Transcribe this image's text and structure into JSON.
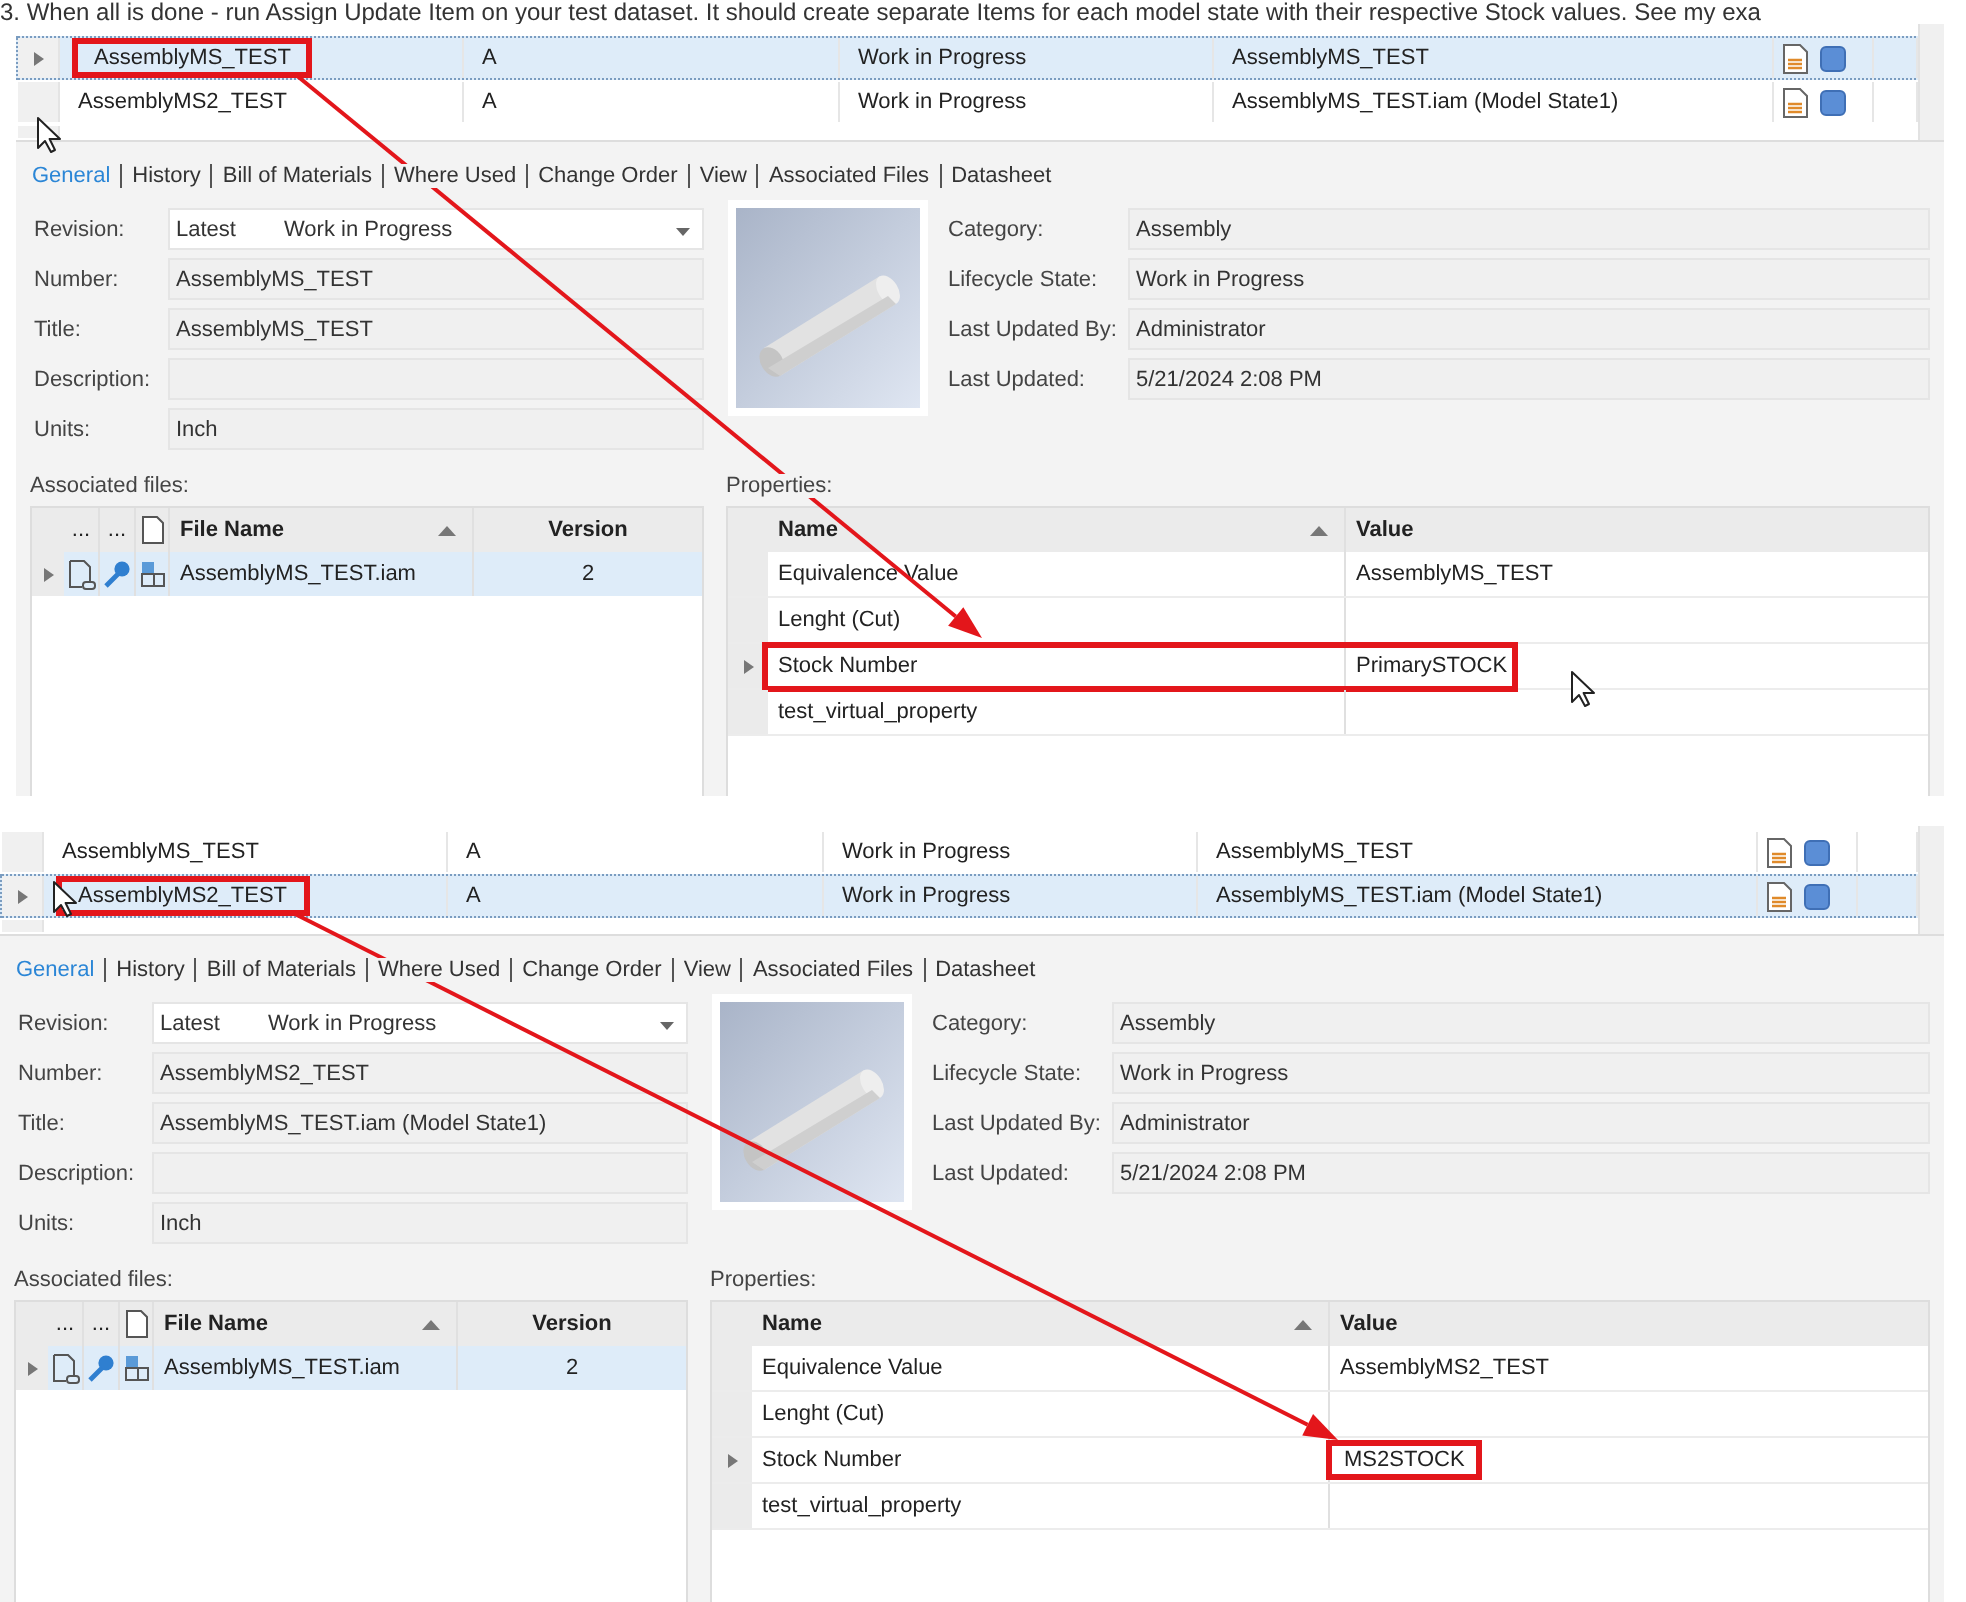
{
  "instruction": "3. When all is done - run Assign Update Item on your test dataset. It should create separate Items for each model state with their respective Stock values. See my exa",
  "panels": [
    {
      "rows": [
        {
          "name": "AssemblyMS_TEST",
          "revision": "A",
          "state": "Work in Progress",
          "title": "AssemblyMS_TEST",
          "selected": true,
          "annotated": true
        },
        {
          "name": "AssemblyMS2_TEST",
          "revision": "A",
          "state": "Work in Progress",
          "title": "AssemblyMS_TEST.iam (Model State1)",
          "selected": false,
          "annotated": false
        }
      ],
      "tabs": [
        {
          "label": "General",
          "selected": true
        },
        {
          "label": "History",
          "selected": false
        },
        {
          "label": "Bill of Materials",
          "selected": false
        },
        {
          "label": "Where Used",
          "selected": false
        },
        {
          "label": "Change Order",
          "selected": false
        },
        {
          "label": "View",
          "selected": false
        },
        {
          "label": "Associated Files",
          "selected": false
        },
        {
          "label": "Datasheet",
          "selected": false
        }
      ],
      "fields": [
        {
          "label": "Revision:",
          "kind": "dropdown",
          "value": "Latest",
          "state": "Work in Progress"
        },
        {
          "label": "Number:",
          "kind": "text",
          "value": "AssemblyMS_TEST"
        },
        {
          "label": "Title:",
          "kind": "text",
          "value": "AssemblyMS_TEST"
        },
        {
          "label": "Description:",
          "kind": "text"
        },
        {
          "label": "Units:",
          "kind": "text",
          "value": "Inch"
        }
      ],
      "info_fields": [
        {
          "label": "Category:",
          "value": "Assembly"
        },
        {
          "label": "Lifecycle State:",
          "value": "Work in Progress"
        },
        {
          "label": "Last Updated By:",
          "value": "Administrator"
        },
        {
          "label": "Last Updated:",
          "value": "5/21/2024 2:08 PM"
        }
      ],
      "associated_files": {
        "label": "Associated files:",
        "columns": [
          "...",
          "...",
          "File Name",
          "Version"
        ],
        "rows": [
          {
            "file_name": "AssemblyMS_TEST.iam",
            "version": "2",
            "selected": true
          }
        ]
      },
      "properties": {
        "label": "Properties:",
        "columns": [
          "Name",
          "Value"
        ],
        "rows": [
          {
            "name": "Equivalence Value",
            "value": "AssemblyMS_TEST",
            "expandable": false,
            "row_annotated": false,
            "value_annotated": false
          },
          {
            "name": "Lenght (Cut)",
            "expandable": false,
            "row_annotated": false,
            "value_annotated": false
          },
          {
            "name": "Stock Number",
            "value": "PrimarySTOCK",
            "expandable": true,
            "row_annotated": true,
            "value_annotated": false
          },
          {
            "name": "test_virtual_property",
            "expandable": false,
            "row_annotated": false,
            "value_annotated": false
          }
        ]
      }
    },
    {
      "rows": [
        {
          "name": "AssemblyMS_TEST",
          "revision": "A",
          "state": "Work in Progress",
          "title": "AssemblyMS_TEST",
          "selected": false,
          "annotated": false
        },
        {
          "name": "AssemblyMS2_TEST",
          "revision": "A",
          "state": "Work in Progress",
          "title": "AssemblyMS_TEST.iam (Model State1)",
          "selected": true,
          "annotated": true
        }
      ],
      "tabs": [
        {
          "label": "General",
          "selected": true
        },
        {
          "label": "History",
          "selected": false
        },
        {
          "label": "Bill of Materials",
          "selected": false
        },
        {
          "label": "Where Used",
          "selected": false
        },
        {
          "label": "Change Order",
          "selected": false
        },
        {
          "label": "View",
          "selected": false
        },
        {
          "label": "Associated Files",
          "selected": false
        },
        {
          "label": "Datasheet",
          "selected": false
        }
      ],
      "fields": [
        {
          "label": "Revision:",
          "kind": "dropdown",
          "value": "Latest",
          "state": "Work in Progress"
        },
        {
          "label": "Number:",
          "kind": "text",
          "value": "AssemblyMS2_TEST"
        },
        {
          "label": "Title:",
          "kind": "text",
          "value": "AssemblyMS_TEST.iam (Model State1)"
        },
        {
          "label": "Description:",
          "kind": "text"
        },
        {
          "label": "Units:",
          "kind": "text",
          "value": "Inch"
        }
      ],
      "info_fields": [
        {
          "label": "Category:",
          "value": "Assembly"
        },
        {
          "label": "Lifecycle State:",
          "value": "Work in Progress"
        },
        {
          "label": "Last Updated By:",
          "value": "Administrator"
        },
        {
          "label": "Last Updated:",
          "value": "5/21/2024 2:08 PM"
        }
      ],
      "associated_files": {
        "label": "Associated files:",
        "columns": [
          "...",
          "...",
          "File Name",
          "Version"
        ],
        "rows": [
          {
            "file_name": "AssemblyMS_TEST.iam",
            "version": "2",
            "selected": true
          }
        ]
      },
      "properties": {
        "label": "Properties:",
        "columns": [
          "Name",
          "Value"
        ],
        "rows": [
          {
            "name": "Equivalence Value",
            "value": "AssemblyMS2_TEST",
            "expandable": false,
            "row_annotated": false,
            "value_annotated": false
          },
          {
            "name": "Lenght (Cut)",
            "expandable": false,
            "row_annotated": false,
            "value_annotated": false
          },
          {
            "name": "Stock Number",
            "value": "MS2STOCK",
            "expandable": true,
            "row_annotated": false,
            "value_annotated": true
          },
          {
            "name": "test_virtual_property",
            "expandable": false,
            "row_annotated": false,
            "value_annotated": false
          }
        ]
      }
    }
  ]
}
